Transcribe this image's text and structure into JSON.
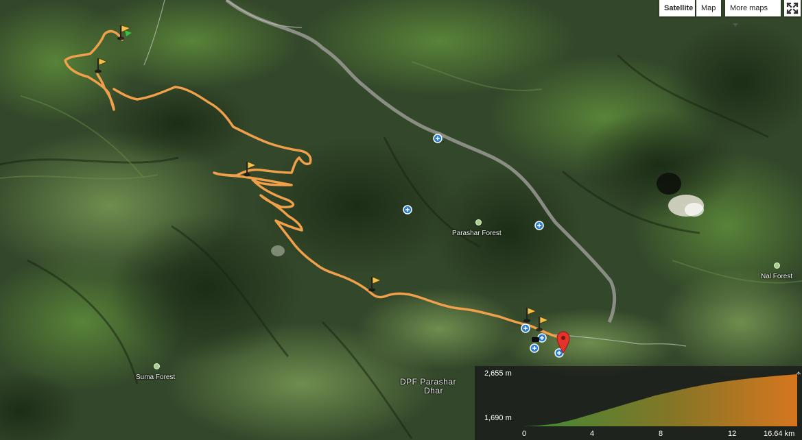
{
  "map_controls": {
    "satellite_label": "Satellite",
    "map_label": "Map",
    "more_maps_label": "More maps",
    "fullscreen_icon": "fullscreen-icon"
  },
  "places": {
    "parashar_forest": "Parashar Forest",
    "nal_forest": "Nal Forest",
    "suma_forest": "Suma Forest",
    "dpf_line1": "DPF Parashar",
    "dpf_line2": "Dhar"
  },
  "elevation": {
    "max_label": "2,655 m",
    "min_label": "1,690 m",
    "x_ticks": [
      "0",
      "4",
      "8",
      "12",
      "16.64 km"
    ],
    "profile_km": [
      0,
      1,
      2,
      3,
      4,
      5,
      6,
      7,
      8,
      9,
      10,
      11,
      12,
      13,
      14,
      15,
      16,
      16.64
    ],
    "profile_m": [
      1690,
      1705,
      1740,
      1810,
      1900,
      1990,
      2080,
      2170,
      2260,
      2330,
      2400,
      2460,
      2510,
      2550,
      2585,
      2615,
      2640,
      2655
    ],
    "colors": {
      "low": "#3f8f3a",
      "high": "#e07a1f"
    }
  },
  "route": {
    "color": "#f0a04b",
    "waypoint_flags": 6,
    "end_marker_color": "#e3332b"
  },
  "colors": {
    "accent": "#f0a04b",
    "marker": "#e3332b",
    "poi": "#2a7fd4"
  }
}
